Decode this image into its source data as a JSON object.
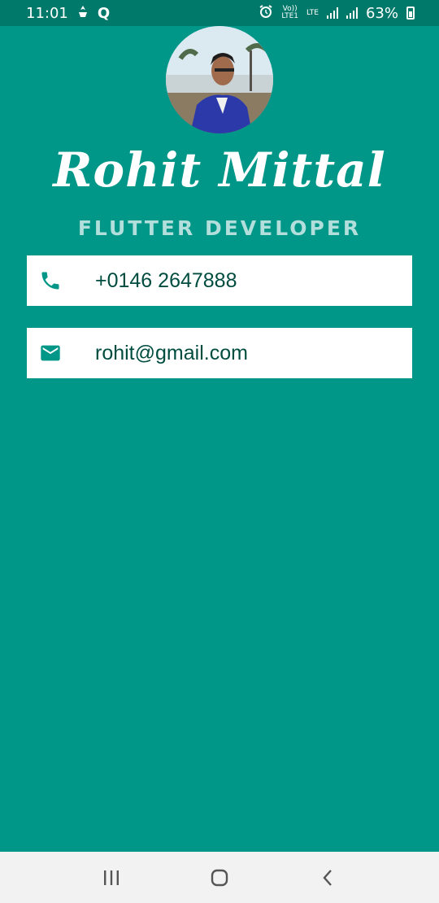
{
  "status_bar": {
    "time": "11:01",
    "indicators": [
      "Q"
    ],
    "network_small_top": "Vo))",
    "network_small_bottom": "LTE1",
    "lte_label": "LTE",
    "battery": "63%"
  },
  "profile": {
    "avatar_description_icon": "avatar-photo",
    "name": "Rohit  Mittal",
    "title": "FLUTTER DEVELOPER"
  },
  "contacts": [
    {
      "icon": "phone-icon",
      "value": "+0146 2647888"
    },
    {
      "icon": "email-icon",
      "value": "rohit@gmail.com"
    }
  ],
  "colors": {
    "background": "#009688",
    "status_bar": "#00796b",
    "accent_text": "#b2dfdb",
    "card_text": "#004d40",
    "icon": "#009688"
  },
  "nav": [
    "recent-apps-icon",
    "home-icon",
    "back-icon"
  ]
}
